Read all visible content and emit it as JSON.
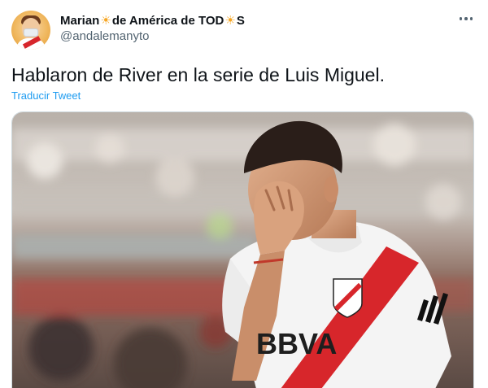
{
  "author": {
    "name_part1": "Marian",
    "name_part2": " de América de TOD",
    "name_part3": "S",
    "sun_glyph": "☀",
    "handle": "@andalemanyto"
  },
  "tweet": {
    "text": "Hablaron de River en la serie de Luis Miguel.",
    "translate_label": "Traducir Tweet"
  },
  "media": {
    "jersey_sponsor": "BBVA",
    "icons": [
      "avatar",
      "more-options-icon",
      "river-plate-crest-icon",
      "sponsor-logo"
    ]
  },
  "colors": {
    "link": "#1d9bf0",
    "secondary_text": "#536471",
    "sun": "#f6a623",
    "jersey_red": "#d7262b"
  }
}
